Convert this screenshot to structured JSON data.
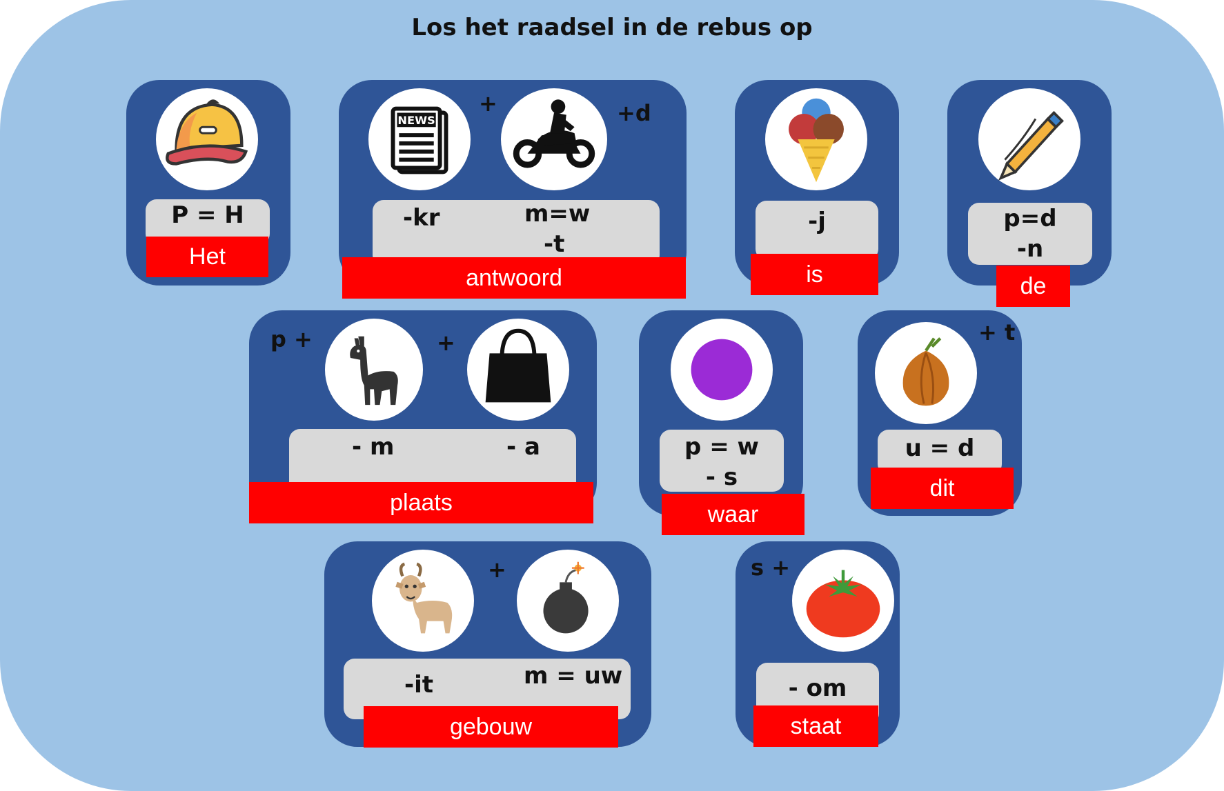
{
  "title": "Los het raadsel in de rebus op",
  "cards": {
    "het": {
      "hint": "P = H",
      "answer": "Het",
      "icon": "cap-icon"
    },
    "antwoord": {
      "hint1": "-kr",
      "hint2a": "m=w",
      "hint2b": "-t",
      "plus": "+",
      "suffix": "+d",
      "answer": "antwoord",
      "icons": [
        "newspaper-icon",
        "motorcycle-icon"
      ]
    },
    "is": {
      "hint": "-j",
      "answer": "is",
      "icon": "ice-cream-icon"
    },
    "de": {
      "hint_a": "p=d",
      "hint_b": "-n",
      "answer": "de",
      "icon": "pen-icon"
    },
    "plaats": {
      "prefix": "p +",
      "plus": "+",
      "hint1": "- m",
      "hint2": "- a",
      "answer": "plaats",
      "icons": [
        "llama-icon",
        "bag-icon"
      ]
    },
    "waar": {
      "hint_a": "p = w",
      "hint_b": "- s",
      "answer": "waar",
      "icon": "purple-dot-icon"
    },
    "dit": {
      "suffix": "+ t",
      "hint": "u = d",
      "answer": "dit",
      "icon": "onion-icon"
    },
    "gebouw": {
      "plus": "+",
      "hint1": "-it",
      "hint2": "m = uw",
      "answer": "gebouw",
      "icons": [
        "goat-icon",
        "bomb-icon"
      ]
    },
    "staat": {
      "prefix": "s +",
      "hint": "- om",
      "answer": "staat",
      "icon": "tomato-icon"
    }
  },
  "colors": {
    "background": "#9dc3e6",
    "card": "#2f5597",
    "hint": "#d9d9d9",
    "answer": "#ff0000"
  }
}
